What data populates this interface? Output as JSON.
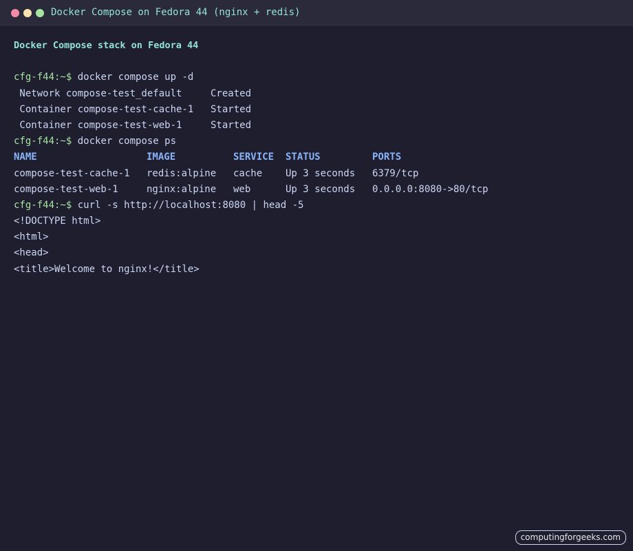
{
  "window": {
    "title": "Docker Compose on Fedora 44 (nginx + redis)",
    "colors": {
      "background": "#1e1e2e",
      "titlebar": "#2a2a3a",
      "close_dot": "#f38ba8",
      "minimize_dot": "#f9e2af",
      "maximize_dot": "#a6e3a1",
      "prompt": "#a6e3a1",
      "heading": "#94e2d5",
      "table_header": "#89b4fa",
      "text": "#cdd6f4"
    }
  },
  "terminal": {
    "heading": "Docker Compose stack on Fedora 44",
    "prompt": "cfg-f44:~$",
    "commands": {
      "up": "docker compose up -d",
      "ps": "docker compose ps",
      "curl": "curl -s http://localhost:8080 | head -5"
    },
    "up_output": [
      {
        "resource": " Network compose-test_default",
        "state": "Created"
      },
      {
        "resource": " Container compose-test-cache-1",
        "state": "Started"
      },
      {
        "resource": " Container compose-test-web-1",
        "state": "Started"
      }
    ],
    "ps_table": {
      "headers": [
        "NAME",
        "IMAGE",
        "SERVICE",
        "STATUS",
        "PORTS"
      ],
      "rows": [
        [
          "compose-test-cache-1",
          "redis:alpine",
          "cache",
          "Up 3 seconds",
          "6379/tcp"
        ],
        [
          "compose-test-web-1",
          "nginx:alpine",
          "web",
          "Up 3 seconds",
          "0.0.0.0:8080->80/tcp"
        ]
      ]
    },
    "curl_output": [
      "<!DOCTYPE html>",
      "<html>",
      "<head>",
      "<title>Welcome to nginx!</title>"
    ]
  },
  "watermark": "computingforgeeks.com"
}
